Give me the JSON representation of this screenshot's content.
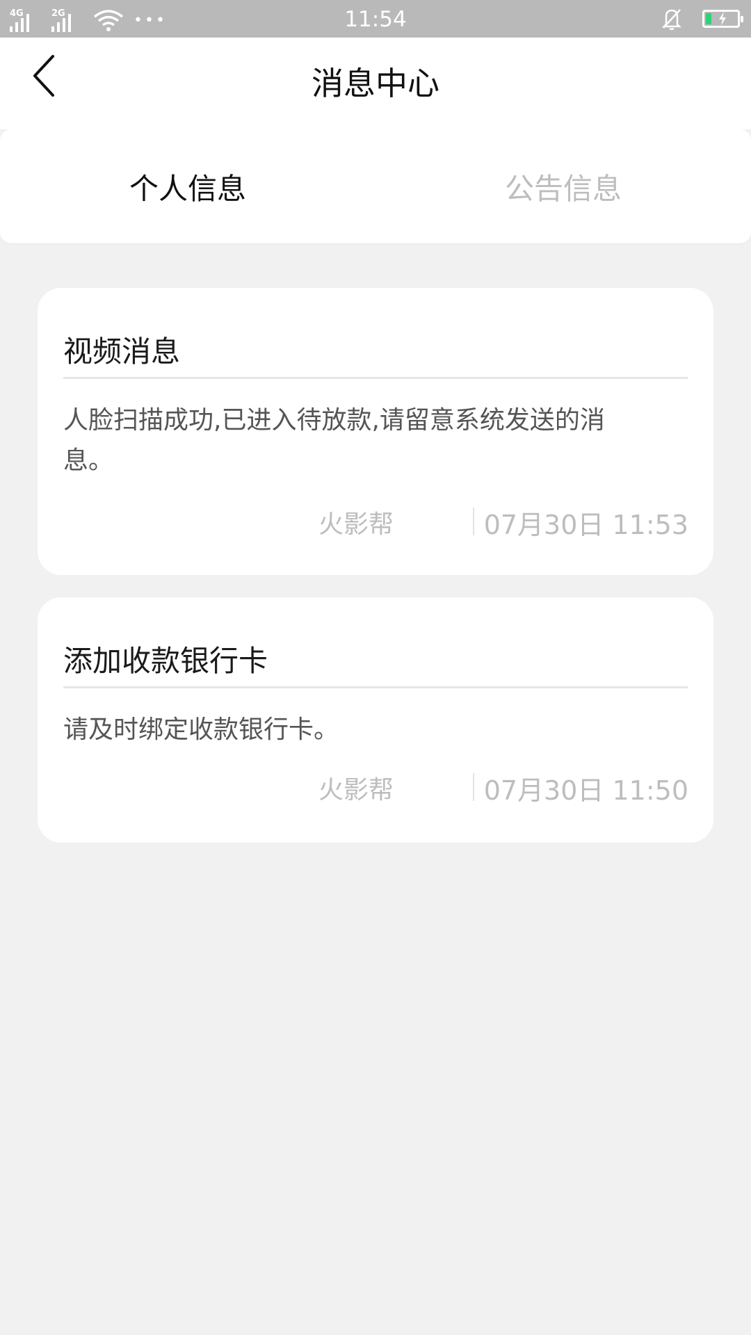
{
  "status_bar": {
    "network_1": "4G",
    "network_2": "2G",
    "more": "•••",
    "time": "11:54",
    "battery_color": "#2fd27a"
  },
  "header": {
    "title": "消息中心",
    "back_icon": "chevron-left-icon"
  },
  "tabs": [
    {
      "label": "个人信息",
      "active": true
    },
    {
      "label": "公告信息",
      "active": false
    }
  ],
  "messages": [
    {
      "title": "视频消息",
      "body": "人脸扫描成功,已进入待放款,请留意系统发送的消息。",
      "source": "火影帮",
      "time": "07月30日 11:53"
    },
    {
      "title": "添加收款银行卡",
      "body": "请及时绑定收款银行卡。",
      "source": "火影帮",
      "time": "07月30日 11:50"
    }
  ]
}
